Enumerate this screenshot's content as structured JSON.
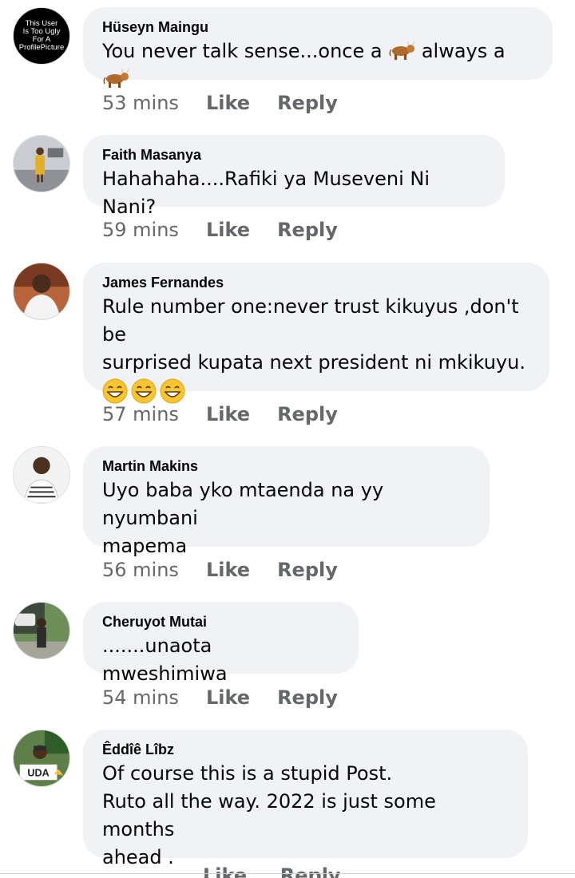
{
  "comments": [
    {
      "author": "Hüseyn Maingu",
      "text_parts": [
        "You never talk sense...once a ",
        " always a "
      ],
      "emoji": "cow",
      "time": "53 mins",
      "like": "Like",
      "reply": "Reply",
      "avatar_text": [
        "This User",
        "Is Too Ugly",
        "For A",
        "ProfilePicture"
      ]
    },
    {
      "author": "Faith Masanya",
      "text": "Hahahaha....Rafiki ya Museveni Ni Nani?",
      "time": "59 mins",
      "like": "Like",
      "reply": "Reply"
    },
    {
      "author": "James Fernandes",
      "text": "Rule number one:never trust kikuyus ,don't be\nsurprised kupata next president ni mkikuyu.",
      "emoji": "grinning-face",
      "emoji_count": 3,
      "time": "57 mins",
      "like": "Like",
      "reply": "Reply"
    },
    {
      "author": "Martin Makins",
      "text": "Uyo baba yko mtaenda na yy nyumbani\nmapema",
      "time": "56 mins",
      "like": "Like",
      "reply": "Reply"
    },
    {
      "author": "Cheruyot Mutai",
      "text": ".......unaota mweshimiwa",
      "time": "54 mins",
      "like": "Like",
      "reply": "Reply"
    },
    {
      "author": "Êddîê Lîbz",
      "text": "Of course this is a stupid Post.\nRuto all the way. 2022 is just some months\nahead .",
      "avatar_badge": "UDA",
      "time": "",
      "like": "Like",
      "reply": "Reply"
    }
  ],
  "colors": {
    "bubble": "#f0f2f5",
    "meta": "#65676b",
    "text": "#050505"
  }
}
